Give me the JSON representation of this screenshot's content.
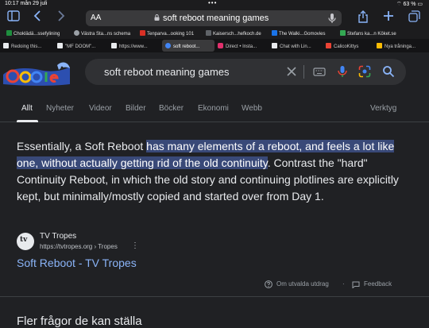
{
  "status": {
    "time": "10:17",
    "date": "mån 29 juli",
    "dots": "•••",
    "right": "⌔ 63 % ▭"
  },
  "toolbar": {
    "aa": "AA",
    "url": "soft reboot meaning games"
  },
  "bookmarks": [
    {
      "label": "Choklädä...ssefylining",
      "color": "#1e8e3e"
    },
    {
      "label": "Västra Sta...ns schema",
      "color": "#9aa0a6"
    },
    {
      "label": "Tenparva...ooking 101",
      "color": "#d93025"
    },
    {
      "label": "Kaisersch...hefkoch.de",
      "color": "#5f6368"
    },
    {
      "label": "The Walki...Gomovies",
      "color": "#1a73e8"
    },
    {
      "label": "Stefans ka...n Köket.se",
      "color": "#34a853"
    }
  ],
  "tabs": [
    {
      "label": "Redoing this...",
      "color": "#e8eaed"
    },
    {
      "label": "\"MF DOOM\"...",
      "color": "#e8eaed"
    },
    {
      "label": "https://www...",
      "color": "#e8eaed"
    },
    {
      "label": "soft reboot...",
      "color": "#4285f4",
      "active": true
    },
    {
      "label": "Direct • Insta...",
      "color": "#e1306c"
    },
    {
      "label": "Chat with Lin...",
      "color": "#e8eaed"
    },
    {
      "label": "CalicoKittys",
      "color": "#ea4335"
    },
    {
      "label": "Nya tråninga...",
      "color": "#fbbc04"
    }
  ],
  "search": {
    "query": "soft reboot meaning games"
  },
  "nav": {
    "items": [
      "Allt",
      "Nyheter",
      "Videor",
      "Bilder",
      "Böcker",
      "Ekonomi",
      "Webb"
    ],
    "tools": "Verktyg"
  },
  "snippet": {
    "before": "Essentially, a Soft Reboot ",
    "highlight": "has many elements of a reboot, and feels a lot like one, without actually getting rid of the old continuity",
    "after": ". Contrast the \"hard\" Continuity Reboot, in which the old story and continuing plotlines are explicitly kept, but minimally/mostly copied and started over from Day 1."
  },
  "source": {
    "fav": "tv",
    "name": "TV Tropes",
    "url": "https://tvtropes.org › Tropes",
    "more": "⋮"
  },
  "result_title": "Soft Reboot - TV Tropes",
  "footer": {
    "featured": "Om utvalda utdrag",
    "sep": "·",
    "feedback": "Feedback"
  },
  "paa": "Fler frågor de kan ställa"
}
